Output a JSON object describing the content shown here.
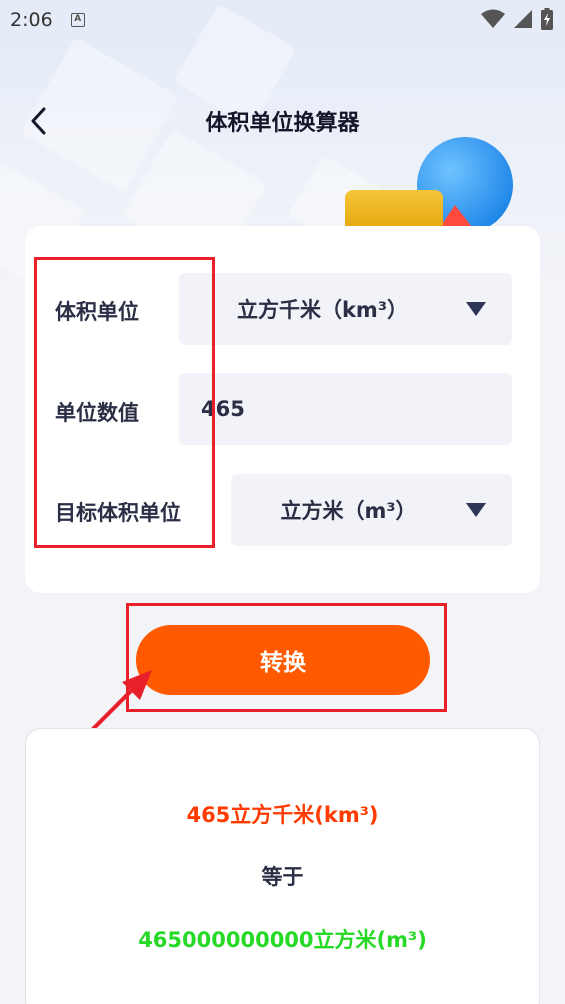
{
  "status_bar": {
    "time": "2:06",
    "notification_icon_letter": "A"
  },
  "header": {
    "title": "体积单位换算器"
  },
  "form": {
    "volume_unit_label": "体积单位",
    "volume_unit_value": "立方千米（km³）",
    "unit_value_label": "单位数值",
    "unit_value_input": "465",
    "target_unit_label": "目标体积单位",
    "target_unit_value": "立方米（m³）"
  },
  "convert_button": {
    "label": "转换"
  },
  "result": {
    "source": "465立方千米(km³)",
    "equals": "等于",
    "target": "465000000000立方米(m³)"
  },
  "colors": {
    "accent": "#ff5a00",
    "annotation_red": "#e8202a",
    "result_source": "#ff3b00",
    "result_target": "#26d926"
  },
  "icons": [
    "a-notification-icon",
    "wifi-icon",
    "signal-icon",
    "battery-icon",
    "back-arrow-icon",
    "dropdown-caret-icon"
  ]
}
